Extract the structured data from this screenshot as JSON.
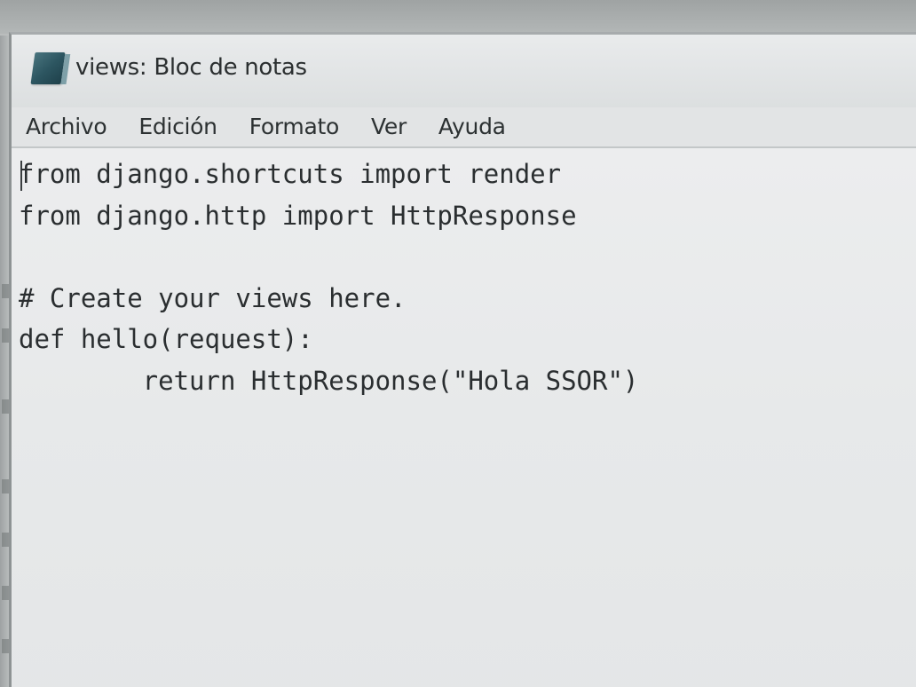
{
  "window": {
    "title": "views: Bloc de notas"
  },
  "menu": {
    "items": [
      "Archivo",
      "Edición",
      "Formato",
      "Ver",
      "Ayuda"
    ]
  },
  "editor": {
    "lines": [
      "from django.shortcuts import render",
      "from django.http import HttpResponse",
      "",
      "# Create your views here.",
      "def hello(request):",
      "        return HttpResponse(\"Hola SSOR\")"
    ]
  },
  "icons": {
    "app": "notepad-icon"
  }
}
